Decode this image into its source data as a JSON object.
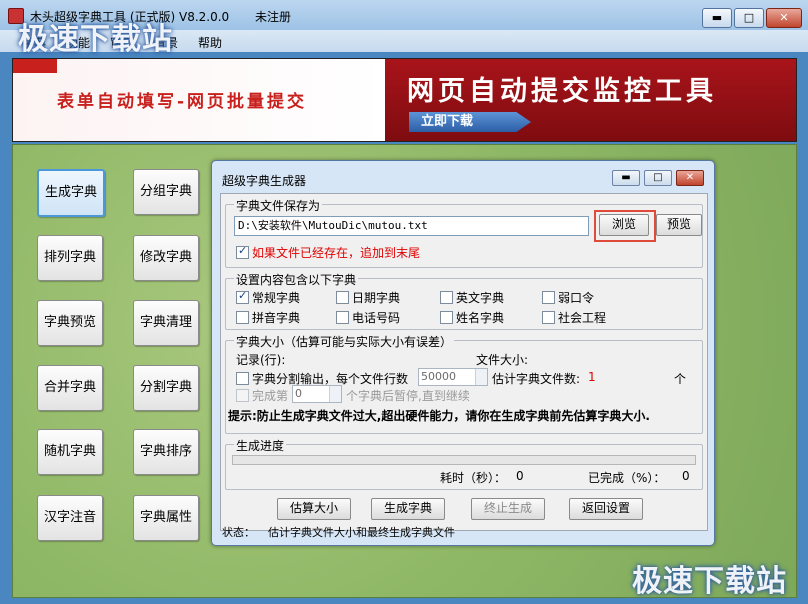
{
  "window": {
    "title": "木头超级字典工具 (正式版) V8.2.0.0",
    "registration": "未注册",
    "minimize": "▬",
    "maximize": "□",
    "close": "✕"
  },
  "menu": [
    "字典",
    "功能",
    "窗口",
    "背景",
    "帮助"
  ],
  "banner": {
    "left_text": "表单自动填写-网页批量提交",
    "right_title": "网页自动提交监控工具",
    "download": "立即下载"
  },
  "sidebar": [
    "生成字典",
    "分组字典",
    "排列字典",
    "修改字典",
    "字典预览",
    "字典清理",
    "合并字典",
    "分割字典",
    "随机字典",
    "字典排序",
    "汉字注音",
    "字典属性"
  ],
  "dialog": {
    "title": "超级字典生成器",
    "save_group": {
      "label": "字典文件保存为",
      "path": "D:\\安装软件\\MutouDic\\mutou.txt",
      "browse": "浏览",
      "preview": "预览",
      "append_label": "如果文件已经存在，追加到末尾",
      "append_checked": true
    },
    "content_group": {
      "label": "设置内容包含以下字典",
      "options": [
        {
          "label": "常规字典",
          "checked": true
        },
        {
          "label": "日期字典",
          "checked": false
        },
        {
          "label": "英文字典",
          "checked": false
        },
        {
          "label": "弱口令",
          "checked": false
        },
        {
          "label": "拼音字典",
          "checked": false
        },
        {
          "label": "电话号码",
          "checked": false
        },
        {
          "label": "姓名字典",
          "checked": false
        },
        {
          "label": "社会工程",
          "checked": false
        }
      ]
    },
    "size_group": {
      "label": "字典大小（估算可能与实际大小有误差）",
      "records_label": "记录(行):",
      "filesize_label": "文件大小:",
      "split_label": "字典分割输出，每个文件行数",
      "split_value": "50000",
      "estimate_label": "估计字典文件数:",
      "estimate_value": "1",
      "estimate_unit": "个",
      "finish_label": "完成第",
      "finish_value": "0",
      "finish_suffix": "个字典后暂停,直到继续",
      "tip": "提示:防止生成字典文件过大,超出硬件能力，请你在生成字典前先估算字典大小."
    },
    "progress_group": {
      "label": "生成进度",
      "progress": 0,
      "time_label": "耗时（秒）：",
      "time_value": "0",
      "done_label": "已完成（%）：",
      "done_value": "0"
    },
    "actions": {
      "estimate": "估算大小",
      "generate": "生成字典",
      "stop": "终止生成",
      "back": "返回设置"
    },
    "status_label": "状态：",
    "status_text": "估计字典文件大小和最终生成字典文件"
  },
  "watermark": "极速下载站"
}
